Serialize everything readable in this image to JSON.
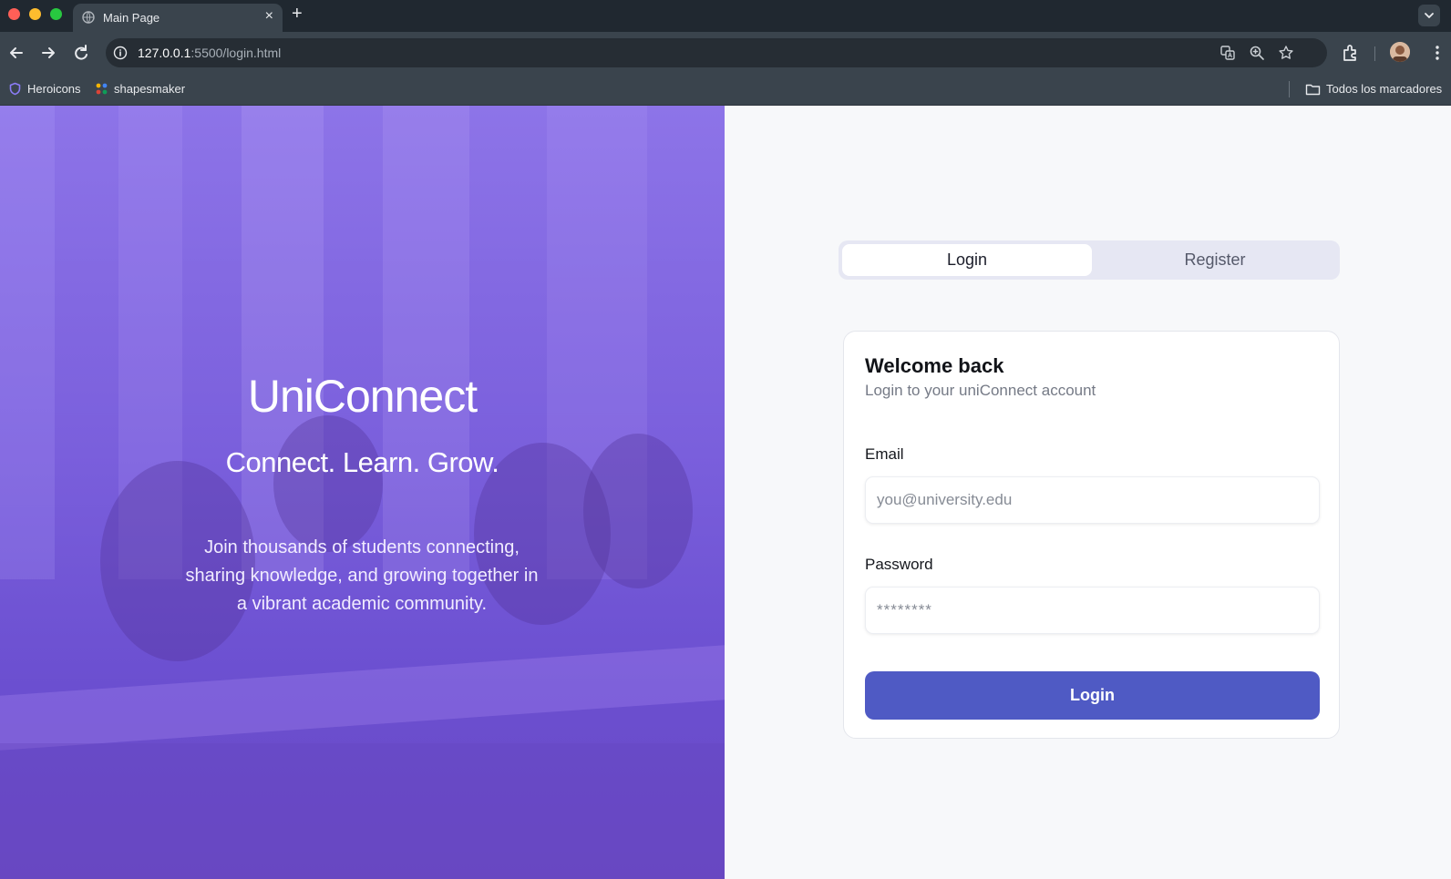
{
  "browser": {
    "tab_title": "Main Page",
    "tab_close": "×",
    "new_tab": "+",
    "url_host": "127.0.0.1",
    "url_rest": ":5500/login.html",
    "bookmarks": [
      {
        "label": "Heroicons",
        "icon": "shield-icon"
      },
      {
        "label": "shapesmaker",
        "icon": "dots-icon"
      }
    ],
    "all_bookmarks": "Todos los marcadores"
  },
  "hero": {
    "brand": "UniConnect",
    "slogan": "Connect. Learn. Grow.",
    "blurb": "Join thousands of students connecting, sharing knowledge, and growing together in a vibrant academic community."
  },
  "auth": {
    "tabs": {
      "login": "Login",
      "register": "Register"
    },
    "title": "Welcome back",
    "subtitle": "Login to your uniConnect account",
    "email_label": "Email",
    "email_placeholder": "you@university.edu",
    "password_label": "Password",
    "password_value": "********",
    "submit_label": "Login"
  },
  "colors": {
    "accent": "#4f5ac4",
    "hero_overlay": "#7a5fdc",
    "chrome": "#3a444d"
  }
}
